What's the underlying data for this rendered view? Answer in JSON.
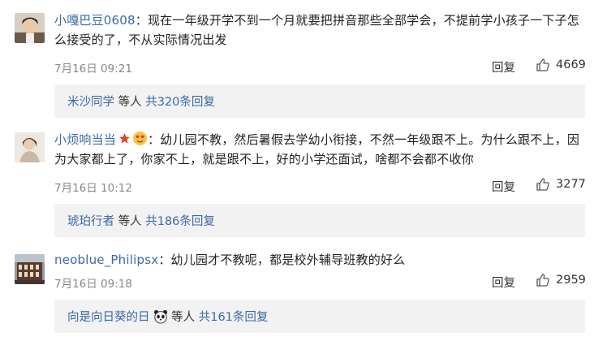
{
  "comments": [
    {
      "user": "小嘎巴豆0608",
      "text": "：现在一年级开学不到一个月就要把拼音那些全部学会，不提前学小孩子一下子怎么接受的了，不从实际情况出发",
      "time": "7月16日 09:21",
      "reply_label": "回复",
      "likes": "4669",
      "reply_user": "米沙同学",
      "reply_mid": " 等人 ",
      "reply_count": "共320条回复"
    },
    {
      "user": "小烦响当当",
      "text": "：幼儿园不教，然后暑假去学幼小衔接，不然一年级跟不上。为什么跟不上，因为大家都上了，你家不上，就是跟不上，好的小学还面试，啥都不会都不收你",
      "time": "7月16日 10:12",
      "reply_label": "回复",
      "likes": "3277",
      "reply_user": "琥珀行者",
      "reply_mid": " 等人 ",
      "reply_count": "共186条回复"
    },
    {
      "user": "neoblue_Philipsx",
      "text": "：幼儿园才不教呢，都是校外辅导班教的好么",
      "time": "7月16日 09:18",
      "reply_label": "回复",
      "likes": "2959",
      "reply_user": "向是向日葵的日",
      "reply_mid": " 等人 ",
      "reply_count": "共161条回复"
    }
  ],
  "colors": {
    "link": "#3a68a8",
    "meta": "#888888",
    "reply_bg": "#f2f2f2"
  },
  "icons": [
    "avatar",
    "thumb-up-icon",
    "star-badge-icon",
    "heart-eyes-emoji-icon",
    "panda-emoji-icon"
  ]
}
